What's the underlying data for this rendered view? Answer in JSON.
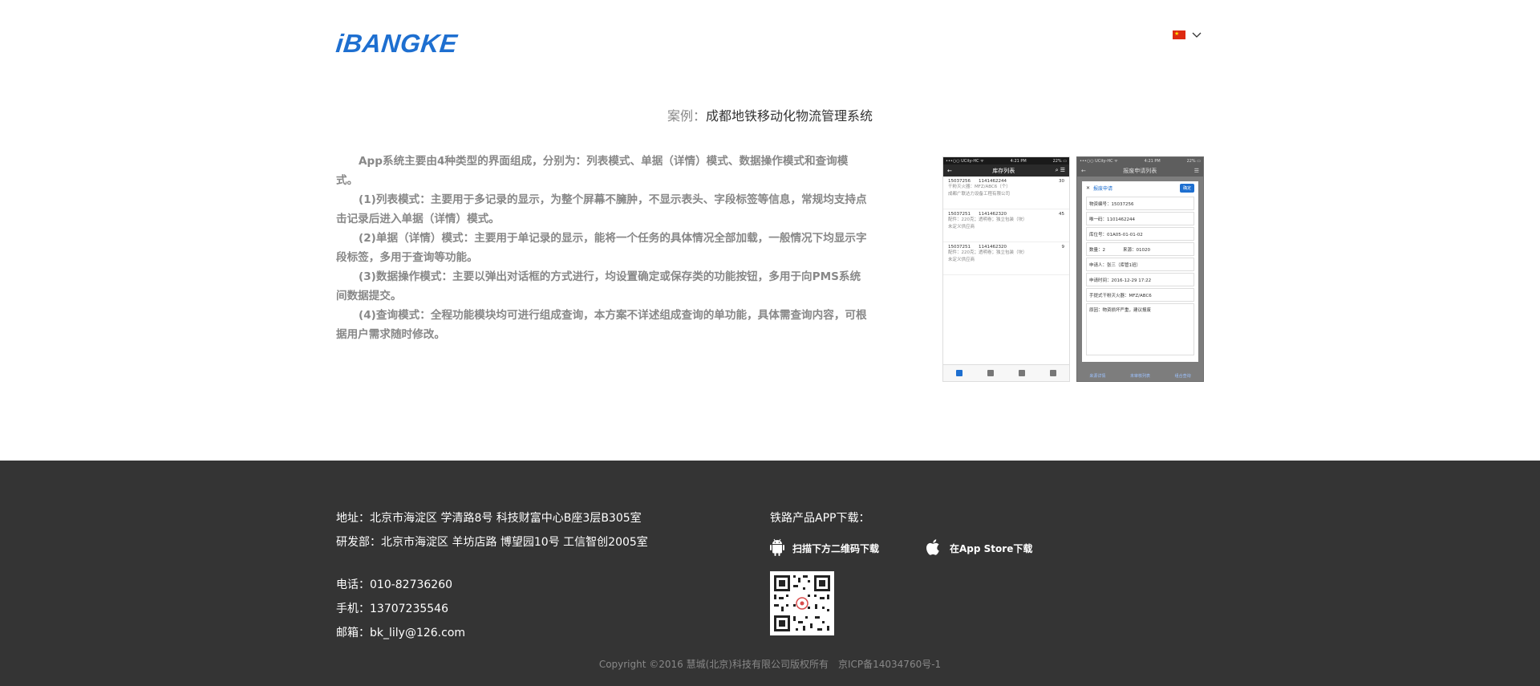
{
  "header": {
    "logo_text": "iBANGKE",
    "language_flag": "china-flag"
  },
  "case": {
    "prefix": "案例：",
    "title": "成都地铁移动化物流管理系统"
  },
  "description": [
    "App系统主要由4种类型的界面组成，分别为：列表模式、单据（详情）模式、数据操作模式和查询模式。",
    "(1)列表模式：主要用于多记录的显示，为整个屏幕不臃肿，不显示表头、字段标签等信息，常规均支持点击记录后进入单据（详情）模式。",
    "(2)单据（详情）模式：主要用于单记录的显示，能将一个任务的具体情况全部加载，一般情况下均显示字段标签，多用于查询等功能。",
    "(3)数据操作模式：主要以弹出对话框的方式进行，均设置确定或保存类的功能按钮，多用于向PMS系统间数据提交。",
    "(4)查询模式：全程功能模块均可进行组成查询，本方案不详述组成查询的单功能，具体需查询内容，可根据用户需求随时修改。"
  ],
  "phone1": {
    "status_left": "•••○○ UCity-HC ᯤ",
    "status_time": "4:21 PM",
    "status_right": "22% ▭",
    "nav_title": "库存列表",
    "items": [
      {
        "code": "15037256",
        "num": "1141462244",
        "qty": "30",
        "line2": "干粉灭火器：MFZ/ABC6（个）",
        "line3": "成都广联达力设备工程有限公司"
      },
      {
        "code": "15037251",
        "num": "1141462320",
        "qty": "45",
        "line2": "配件：220克；透明卷；独立包装（块）",
        "line3": "未定义供应商"
      },
      {
        "code": "15037251",
        "num": "1141462320",
        "qty": "9",
        "line2": "配件：220克；透明卷；独立包装（块）",
        "line3": "未定义供应商"
      }
    ]
  },
  "phone2": {
    "status_left": "•••○○ UCity-HC ᯤ",
    "status_time": "4:21 PM",
    "status_right": "22% ▭",
    "nav_title": "报废申请列表",
    "dialog_title": "报废申请",
    "confirm_label": "确定",
    "fields": [
      "物资编号：15037256",
      "唯一码：1101462244",
      "库位号：01A05-01-01-02",
      "数量：2　　　　来源：01020",
      "申请人：张三（库管1班）",
      "申请时间：2016-12-29  17:22",
      "手提式干粉灭火器：MFZ/ABC6"
    ],
    "reason": "原因：物资损坏严重，建议报废",
    "bottom_links": [
      "来源详情",
      "未审核列表",
      "组合查询"
    ]
  },
  "footer": {
    "address": "地址：北京市海淀区 学清路8号 科技财富中心B座3层B305室",
    "rd_address": "研发部：北京市海淀区 羊坊店路 博望园10号 工信智创2005室",
    "phone": "电话：010-82736260",
    "mobile": "手机：13707235546",
    "email": "邮箱：bk_lily@126.com",
    "download_title": "铁路产品APP下载：",
    "android_label": "扫描下方二维码下载",
    "ios_label": "在App Store下载",
    "copyright": "Copyright ©2016 慧城(北京)科技有限公司版权所有　京ICP备14034760号-1"
  }
}
